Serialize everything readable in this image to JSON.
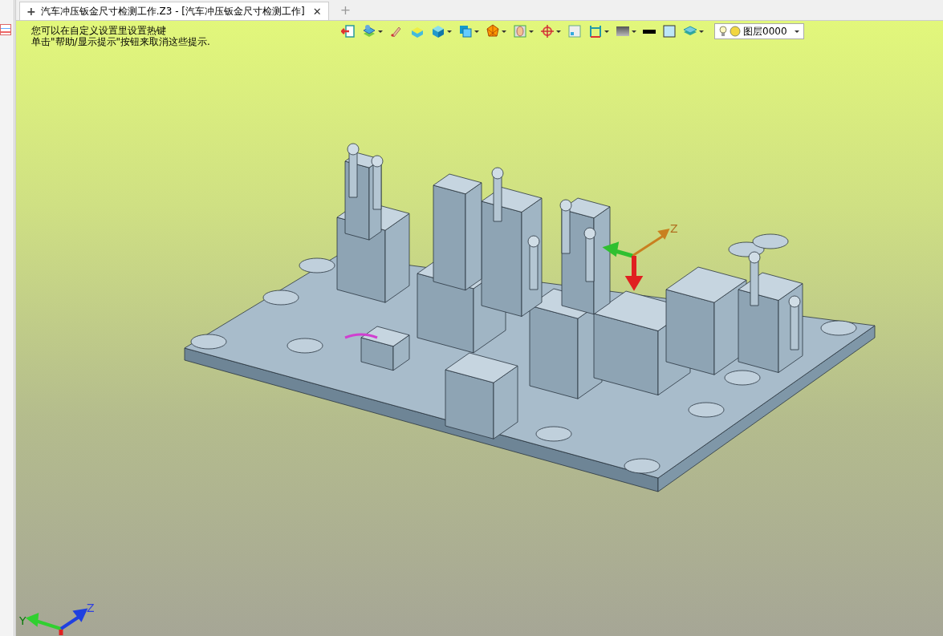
{
  "tabs": [
    {
      "icon": "+",
      "label": "汽车冲压钣金尺寸检测工作.Z3 - [汽车冲压钣金尺寸检测工作]",
      "close": "✕",
      "selected": true
    }
  ],
  "new_tab": "+",
  "hints": [
    "您可以在自定义设置里设置热键",
    "单击\"帮助/显示提示\"按钮来取消这些提示."
  ],
  "toolbar": [
    {
      "kind": "exit",
      "dropdown": false
    },
    {
      "kind": "layers",
      "dropdown": true
    },
    {
      "kind": "brush",
      "dropdown": false
    },
    {
      "kind": "shade",
      "dropdown": false
    },
    {
      "kind": "cube",
      "dropdown": true
    },
    {
      "kind": "view",
      "dropdown": true
    },
    {
      "kind": "mesh",
      "dropdown": true
    },
    {
      "kind": "frame",
      "dropdown": true
    },
    {
      "kind": "target",
      "dropdown": true
    },
    {
      "kind": "window",
      "dropdown": false
    },
    {
      "kind": "measure",
      "dropdown": true
    },
    {
      "kind": "gradient",
      "dropdown": true
    },
    {
      "kind": "line",
      "dropdown": false
    },
    {
      "kind": "fill",
      "dropdown": false
    },
    {
      "kind": "stack",
      "dropdown": true
    }
  ],
  "layer_select": {
    "value": "图层0000"
  },
  "model_triad": {
    "z_label": "Z"
  },
  "view_triad": {
    "y_label": "Y",
    "z_label": "Z"
  }
}
